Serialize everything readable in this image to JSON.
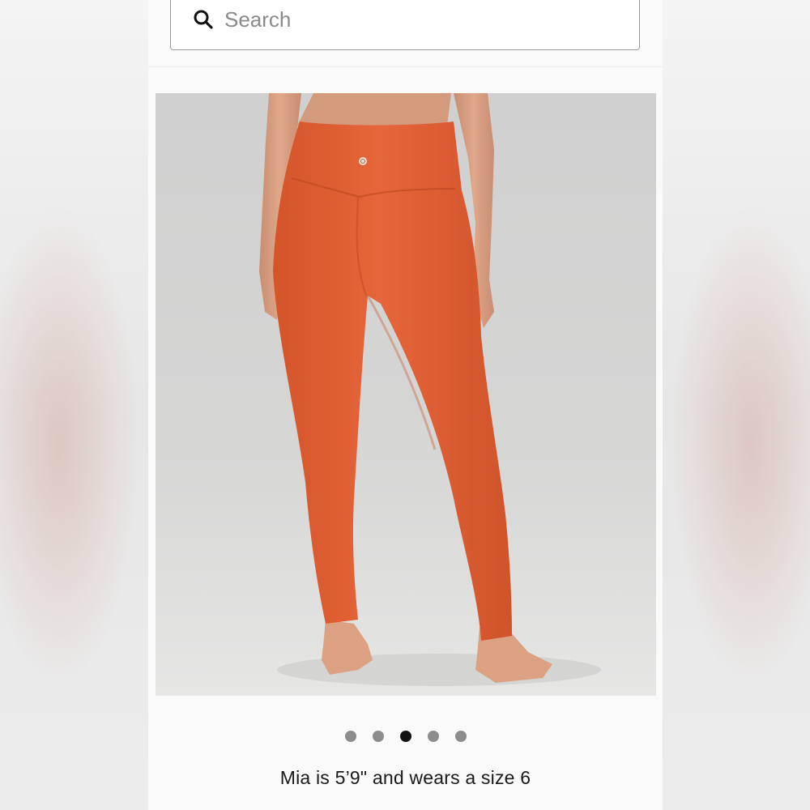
{
  "search": {
    "placeholder": "Search",
    "value": ""
  },
  "product_image": {
    "description_icon": "product-photo",
    "logo_alt": "brand-logo",
    "product_color": "#e25f32",
    "background_color": "#d3d4d3"
  },
  "carousel": {
    "dots": [
      {
        "active": false
      },
      {
        "active": false
      },
      {
        "active": true
      },
      {
        "active": false
      },
      {
        "active": false
      }
    ],
    "current_index": 3,
    "total": 5
  },
  "caption": "Mia is 5’9\" and wears a size 6",
  "colors": {
    "dot_inactive": "#8c8c8c",
    "dot_active": "#111111",
    "text": "#1a1a1a"
  }
}
